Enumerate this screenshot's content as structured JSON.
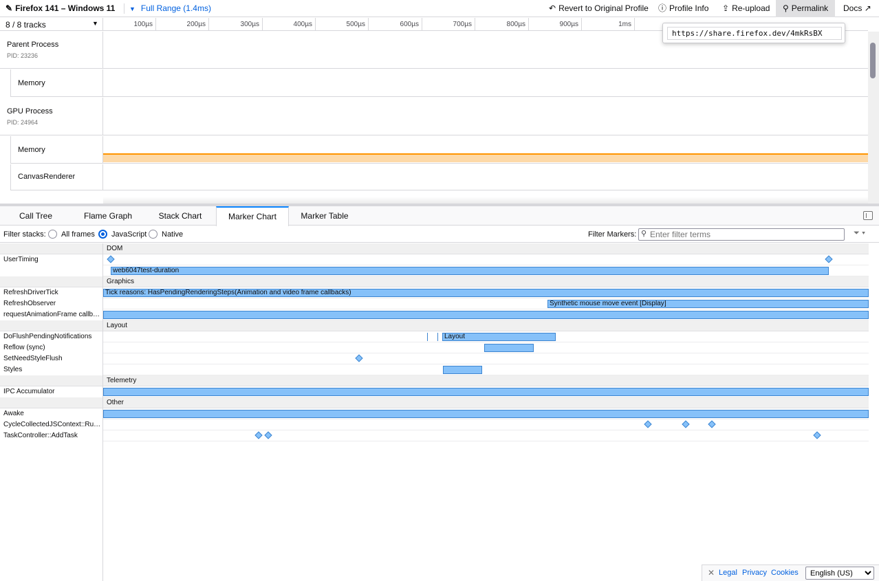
{
  "topbar": {
    "title": "Firefox 141 – Windows 11",
    "range": "Full Range (1.4ms)",
    "revert": "Revert to Original Profile",
    "profile_info": "Profile Info",
    "reupload": "Re-upload",
    "permalink": "Permalink",
    "docs": "Docs"
  },
  "permalink_popup": {
    "url": "https://share.firefox.dev/4mkRsBX"
  },
  "tracks": {
    "count": "8 / 8 tracks",
    "ruler_ticks": [
      "100µs",
      "200µs",
      "300µs",
      "400µs",
      "500µs",
      "600µs",
      "700µs",
      "800µs",
      "900µs",
      "1ms"
    ],
    "parent": {
      "name": "Parent Process",
      "pid": "PID: 23236",
      "memory": "Memory"
    },
    "gpu": {
      "name": "GPU Process",
      "pid": "PID: 24964",
      "memory": "Memory",
      "canvas": "CanvasRenderer"
    }
  },
  "tabs": [
    "Call Tree",
    "Flame Graph",
    "Stack Chart",
    "Marker Chart",
    "Marker Table"
  ],
  "selected_tab": "Marker Chart",
  "settings": {
    "filter_stacks_label": "Filter stacks:",
    "options": [
      "All frames",
      "JavaScript",
      "Native"
    ],
    "selected": "JavaScript",
    "filter_markers_label": "Filter Markers:",
    "filter_placeholder": "Enter filter terms"
  },
  "marker_chart": {
    "categories": {
      "dom": "DOM",
      "graphics": "Graphics",
      "layout": "Layout",
      "telemetry": "Telemetry",
      "other": "Other"
    },
    "rows": {
      "usertiming": "UserTiming",
      "refreshdrivertick": "RefreshDriverTick",
      "refreshobserver": "RefreshObserver",
      "raf": "requestAnimationFrame callb…",
      "doflush": "DoFlushPendingNotifications",
      "reflow": "Reflow (sync)",
      "setneedstyleflush": "SetNeedStyleFlush",
      "styles": "Styles",
      "ipc": "IPC Accumulator",
      "awake": "Awake",
      "cyclecollected": "CycleCollectedJSContext::Ru…",
      "taskcontroller": "TaskController::AddTask"
    },
    "bar_labels": {
      "web6047": "web6047test-duration",
      "tick": "Tick reasons: HasPendingRenderingSteps(Animation and video frame callbacks)",
      "synthetic": "Synthetic mouse move event [Display]",
      "layout": "Layout"
    },
    "colors": {
      "marker_fill": "#86c1f9",
      "marker_border": "#3c85d1"
    }
  },
  "footer": {
    "legal": "Legal",
    "privacy": "Privacy",
    "cookies": "Cookies",
    "language": "English (US)"
  }
}
